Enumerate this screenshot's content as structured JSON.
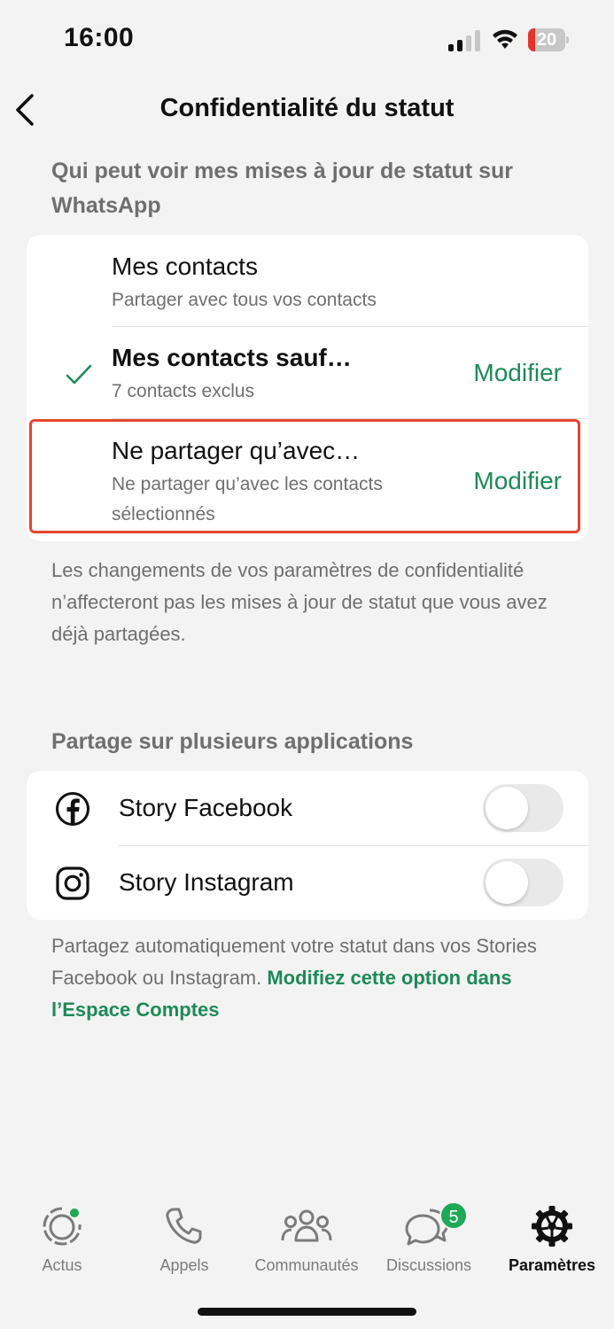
{
  "status_bar": {
    "time": "16:00",
    "battery": "20",
    "battery_level": 0.2
  },
  "nav": {
    "title": "Confidentialité du statut",
    "back_icon": "chevron-left-icon"
  },
  "audience": {
    "header": "Qui peut voir mes mises à jour de statut sur WhatsApp",
    "options": [
      {
        "title": "Mes contacts",
        "subtitle": "Partager avec tous vos contacts",
        "selected": false
      },
      {
        "title": "Mes contacts sauf…",
        "subtitle": "7 contacts exclus",
        "selected": true,
        "action": "Modifier"
      },
      {
        "title": "Ne partager qu’avec…",
        "subtitle": "Ne partager qu’avec les contacts sélectionnés",
        "selected": false,
        "action": "Modifier"
      }
    ],
    "note": "Les changements de vos paramètres de confidentialité n’affecteront pas les mises à jour de statut que vous avez déjà partagées."
  },
  "cross_share": {
    "header": "Partage sur plusieurs applications",
    "items": [
      {
        "label": "Story Facebook",
        "icon": "facebook-icon",
        "enabled": false
      },
      {
        "label": "Story Instagram",
        "icon": "instagram-icon",
        "enabled": false
      }
    ],
    "note_text": "Partagez automatiquement votre statut dans vos Stories Facebook ou Instagram. ",
    "note_link": "Modifiez cette option dans l’Espace Comptes"
  },
  "tab_bar": {
    "tabs": [
      {
        "label": "Actus",
        "icon": "updates-icon"
      },
      {
        "label": "Appels",
        "icon": "phone-icon"
      },
      {
        "label": "Communautés",
        "icon": "communities-icon"
      },
      {
        "label": "Discussions",
        "icon": "chats-icon",
        "badge": "5"
      },
      {
        "label": "Paramètres",
        "icon": "settings-icon",
        "active": true
      }
    ]
  },
  "colors": {
    "accent": "#1d8a57",
    "highlight": "#e4462f",
    "badge": "#1fa855",
    "background": "#f3f3f3"
  }
}
